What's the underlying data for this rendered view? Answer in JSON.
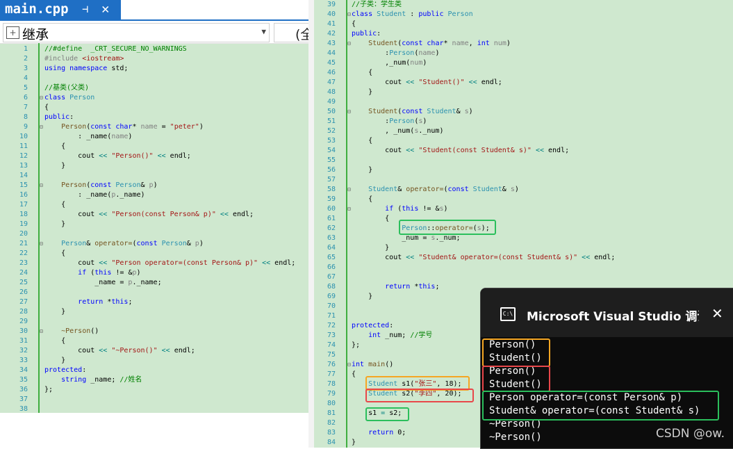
{
  "tab": {
    "title": "main.cpp",
    "pin_glyph": "⊣",
    "close_glyph": "✕"
  },
  "scope": {
    "left_value": "继承",
    "right_value": "(全"
  },
  "left_code": [
    {
      "n": "1",
      "segs": [
        [
          "com",
          "//#define  _CRT_SECURE_NO_WARNINGS"
        ]
      ]
    },
    {
      "n": "2",
      "segs": [
        [
          "pp",
          "#include "
        ],
        [
          "str",
          "<iostream>"
        ]
      ]
    },
    {
      "n": "3",
      "segs": [
        [
          "kw",
          "using namespace "
        ],
        [
          "mem",
          "std;"
        ]
      ]
    },
    {
      "n": "4",
      "segs": []
    },
    {
      "n": "5",
      "segs": [
        [
          "com",
          "//基类(父类)"
        ]
      ]
    },
    {
      "n": "6",
      "segs": [
        [
          "kw",
          "class "
        ],
        [
          "ty",
          "Person"
        ]
      ]
    },
    {
      "n": "7",
      "segs": [
        [
          "mem",
          "{"
        ]
      ]
    },
    {
      "n": "8",
      "segs": [
        [
          "kw",
          "public"
        ],
        [
          "mem",
          ":"
        ]
      ]
    },
    {
      "n": "9",
      "segs": [
        [
          "mem",
          "    "
        ],
        [
          "fn",
          "Person"
        ],
        [
          "mem",
          "("
        ],
        [
          "kw",
          "const char"
        ],
        [
          "mem",
          "* "
        ],
        [
          "par",
          "name"
        ],
        [
          "mem",
          " = "
        ],
        [
          "str",
          "\"peter\""
        ],
        [
          "mem",
          ")"
        ]
      ]
    },
    {
      "n": "10",
      "segs": [
        [
          "mem",
          "        : _name("
        ],
        [
          "par",
          "name"
        ],
        [
          "mem",
          ")"
        ]
      ]
    },
    {
      "n": "11",
      "segs": [
        [
          "mem",
          "    {"
        ]
      ]
    },
    {
      "n": "12",
      "segs": [
        [
          "mem",
          "        cout "
        ],
        [
          "op",
          "<<"
        ],
        [
          "mem",
          " "
        ],
        [
          "str",
          "\"Person()\""
        ],
        [
          "mem",
          " "
        ],
        [
          "op",
          "<<"
        ],
        [
          "mem",
          " endl;"
        ]
      ]
    },
    {
      "n": "13",
      "segs": [
        [
          "mem",
          "    }"
        ]
      ]
    },
    {
      "n": "14",
      "segs": []
    },
    {
      "n": "15",
      "segs": [
        [
          "mem",
          "    "
        ],
        [
          "fn",
          "Person"
        ],
        [
          "mem",
          "("
        ],
        [
          "kw",
          "const "
        ],
        [
          "ty",
          "Person"
        ],
        [
          "mem",
          "& "
        ],
        [
          "par",
          "p"
        ],
        [
          "mem",
          ")"
        ]
      ]
    },
    {
      "n": "16",
      "segs": [
        [
          "mem",
          "        : _name("
        ],
        [
          "par",
          "p"
        ],
        [
          "mem",
          "._name)"
        ]
      ]
    },
    {
      "n": "17",
      "segs": [
        [
          "mem",
          "    {"
        ]
      ]
    },
    {
      "n": "18",
      "segs": [
        [
          "mem",
          "        cout "
        ],
        [
          "op",
          "<<"
        ],
        [
          "mem",
          " "
        ],
        [
          "str",
          "\"Person(const Person& p)\""
        ],
        [
          "mem",
          " "
        ],
        [
          "op",
          "<<"
        ],
        [
          "mem",
          " endl;"
        ]
      ]
    },
    {
      "n": "19",
      "segs": [
        [
          "mem",
          "    }"
        ]
      ]
    },
    {
      "n": "20",
      "segs": []
    },
    {
      "n": "21",
      "segs": [
        [
          "mem",
          "    "
        ],
        [
          "ty",
          "Person"
        ],
        [
          "mem",
          "& "
        ],
        [
          "fn",
          "operator="
        ],
        [
          "mem",
          "("
        ],
        [
          "kw",
          "const "
        ],
        [
          "ty",
          "Person"
        ],
        [
          "mem",
          "& "
        ],
        [
          "par",
          "p"
        ],
        [
          "mem",
          ")"
        ]
      ]
    },
    {
      "n": "22",
      "segs": [
        [
          "mem",
          "    {"
        ]
      ]
    },
    {
      "n": "23",
      "segs": [
        [
          "mem",
          "        cout "
        ],
        [
          "op",
          "<<"
        ],
        [
          "mem",
          " "
        ],
        [
          "str",
          "\"Person operator=(const Person& p)\""
        ],
        [
          "mem",
          " "
        ],
        [
          "op",
          "<<"
        ],
        [
          "mem",
          " endl;"
        ]
      ]
    },
    {
      "n": "24",
      "segs": [
        [
          "mem",
          "        "
        ],
        [
          "kw",
          "if"
        ],
        [
          "mem",
          " ("
        ],
        [
          "kw",
          "this"
        ],
        [
          "mem",
          " != &"
        ],
        [
          "par",
          "p"
        ],
        [
          "mem",
          ")"
        ]
      ]
    },
    {
      "n": "25",
      "segs": [
        [
          "mem",
          "            _name = "
        ],
        [
          "par",
          "p"
        ],
        [
          "mem",
          "._name;"
        ]
      ]
    },
    {
      "n": "26",
      "segs": []
    },
    {
      "n": "27",
      "segs": [
        [
          "mem",
          "        "
        ],
        [
          "kw",
          "return"
        ],
        [
          "mem",
          " *"
        ],
        [
          "kw",
          "this"
        ],
        [
          "mem",
          ";"
        ]
      ]
    },
    {
      "n": "28",
      "segs": [
        [
          "mem",
          "    }"
        ]
      ]
    },
    {
      "n": "29",
      "segs": []
    },
    {
      "n": "30",
      "segs": [
        [
          "mem",
          "    "
        ],
        [
          "fn",
          "~Person"
        ],
        [
          "mem",
          "()"
        ]
      ]
    },
    {
      "n": "31",
      "segs": [
        [
          "mem",
          "    {"
        ]
      ]
    },
    {
      "n": "32",
      "segs": [
        [
          "mem",
          "        cout "
        ],
        [
          "op",
          "<<"
        ],
        [
          "mem",
          " "
        ],
        [
          "str",
          "\"~Person()\""
        ],
        [
          "mem",
          " "
        ],
        [
          "op",
          "<<"
        ],
        [
          "mem",
          " endl;"
        ]
      ]
    },
    {
      "n": "33",
      "segs": [
        [
          "mem",
          "    }"
        ]
      ]
    },
    {
      "n": "34",
      "segs": [
        [
          "kw",
          "protected"
        ],
        [
          "mem",
          ":"
        ]
      ]
    },
    {
      "n": "35",
      "segs": [
        [
          "mem",
          "    "
        ],
        [
          "kw",
          "string"
        ],
        [
          "mem",
          " _name; "
        ],
        [
          "com",
          "//姓名"
        ]
      ]
    },
    {
      "n": "36",
      "segs": [
        [
          "mem",
          "};"
        ]
      ]
    },
    {
      "n": "37",
      "segs": []
    },
    {
      "n": "38",
      "segs": []
    }
  ],
  "right_code": [
    {
      "n": "39",
      "segs": [
        [
          "com",
          "//子类：学生类"
        ]
      ]
    },
    {
      "n": "40",
      "segs": [
        [
          "kw",
          "class "
        ],
        [
          "ty",
          "Student"
        ],
        [
          "mem",
          " : "
        ],
        [
          "kw",
          "public "
        ],
        [
          "ty",
          "Person"
        ]
      ]
    },
    {
      "n": "41",
      "segs": [
        [
          "mem",
          "{"
        ]
      ]
    },
    {
      "n": "42",
      "segs": [
        [
          "kw",
          "public"
        ],
        [
          "mem",
          ":"
        ]
      ]
    },
    {
      "n": "43",
      "segs": [
        [
          "mem",
          "    "
        ],
        [
          "fn",
          "Student"
        ],
        [
          "mem",
          "("
        ],
        [
          "kw",
          "const char"
        ],
        [
          "mem",
          "* "
        ],
        [
          "par",
          "name"
        ],
        [
          "mem",
          ", "
        ],
        [
          "kw",
          "int"
        ],
        [
          "mem",
          " "
        ],
        [
          "par",
          "num"
        ],
        [
          "mem",
          ")"
        ]
      ]
    },
    {
      "n": "44",
      "segs": [
        [
          "mem",
          "        :"
        ],
        [
          "ty",
          "Person"
        ],
        [
          "mem",
          "("
        ],
        [
          "par",
          "name"
        ],
        [
          "mem",
          ")"
        ]
      ]
    },
    {
      "n": "45",
      "segs": [
        [
          "mem",
          "        ,_num("
        ],
        [
          "par",
          "num"
        ],
        [
          "mem",
          ")"
        ]
      ]
    },
    {
      "n": "46",
      "segs": [
        [
          "mem",
          "    {"
        ]
      ]
    },
    {
      "n": "47",
      "segs": [
        [
          "mem",
          "        cout "
        ],
        [
          "op",
          "<<"
        ],
        [
          "mem",
          " "
        ],
        [
          "str",
          "\"Student()\""
        ],
        [
          "mem",
          " "
        ],
        [
          "op",
          "<<"
        ],
        [
          "mem",
          " endl;"
        ]
      ]
    },
    {
      "n": "48",
      "segs": [
        [
          "mem",
          "    }"
        ]
      ]
    },
    {
      "n": "49",
      "segs": []
    },
    {
      "n": "50",
      "segs": [
        [
          "mem",
          "    "
        ],
        [
          "fn",
          "Student"
        ],
        [
          "mem",
          "("
        ],
        [
          "kw",
          "const "
        ],
        [
          "ty",
          "Student"
        ],
        [
          "mem",
          "& "
        ],
        [
          "par",
          "s"
        ],
        [
          "mem",
          ")"
        ]
      ]
    },
    {
      "n": "51",
      "segs": [
        [
          "mem",
          "        :"
        ],
        [
          "ty",
          "Person"
        ],
        [
          "mem",
          "("
        ],
        [
          "par",
          "s"
        ],
        [
          "mem",
          ")"
        ]
      ]
    },
    {
      "n": "52",
      "segs": [
        [
          "mem",
          "        , _num("
        ],
        [
          "par",
          "s"
        ],
        [
          "mem",
          "._num)"
        ]
      ]
    },
    {
      "n": "53",
      "segs": [
        [
          "mem",
          "    {"
        ]
      ]
    },
    {
      "n": "54",
      "segs": [
        [
          "mem",
          "        cout "
        ],
        [
          "op",
          "<<"
        ],
        [
          "mem",
          " "
        ],
        [
          "str",
          "\"Student(const Student& s)\""
        ],
        [
          "mem",
          " "
        ],
        [
          "op",
          "<<"
        ],
        [
          "mem",
          " endl;"
        ]
      ]
    },
    {
      "n": "55",
      "segs": []
    },
    {
      "n": "56",
      "segs": [
        [
          "mem",
          "    }"
        ]
      ]
    },
    {
      "n": "57",
      "segs": []
    },
    {
      "n": "58",
      "segs": [
        [
          "mem",
          "    "
        ],
        [
          "ty",
          "Student"
        ],
        [
          "mem",
          "& "
        ],
        [
          "fn",
          "operator="
        ],
        [
          "mem",
          "("
        ],
        [
          "kw",
          "const "
        ],
        [
          "ty",
          "Student"
        ],
        [
          "mem",
          "& "
        ],
        [
          "par",
          "s"
        ],
        [
          "mem",
          ")"
        ]
      ]
    },
    {
      "n": "59",
      "segs": [
        [
          "mem",
          "    {"
        ]
      ]
    },
    {
      "n": "60",
      "segs": [
        [
          "mem",
          "        "
        ],
        [
          "kw",
          "if"
        ],
        [
          "mem",
          " ("
        ],
        [
          "kw",
          "this"
        ],
        [
          "mem",
          " != &"
        ],
        [
          "par",
          "s"
        ],
        [
          "mem",
          ")"
        ]
      ]
    },
    {
      "n": "61",
      "segs": [
        [
          "mem",
          "        {"
        ]
      ]
    },
    {
      "n": "62",
      "segs": [
        [
          "mem",
          "            "
        ],
        [
          "ty",
          "Person"
        ],
        [
          "mem",
          "::"
        ],
        [
          "fn",
          "operator="
        ],
        [
          "mem",
          "("
        ],
        [
          "par",
          "s"
        ],
        [
          "mem",
          ");"
        ]
      ]
    },
    {
      "n": "63",
      "segs": [
        [
          "mem",
          "            _num = "
        ],
        [
          "par",
          "s"
        ],
        [
          "mem",
          "._num;"
        ]
      ]
    },
    {
      "n": "64",
      "segs": [
        [
          "mem",
          "        }"
        ]
      ]
    },
    {
      "n": "65",
      "segs": [
        [
          "mem",
          "        cout "
        ],
        [
          "op",
          "<<"
        ],
        [
          "mem",
          " "
        ],
        [
          "str",
          "\"Student& operator=(const Student& s)\""
        ],
        [
          "mem",
          " "
        ],
        [
          "op",
          "<<"
        ],
        [
          "mem",
          " endl;"
        ]
      ]
    },
    {
      "n": "66",
      "segs": []
    },
    {
      "n": "67",
      "segs": []
    },
    {
      "n": "68",
      "segs": [
        [
          "mem",
          "        "
        ],
        [
          "kw",
          "return"
        ],
        [
          "mem",
          " *"
        ],
        [
          "kw",
          "this"
        ],
        [
          "mem",
          ";"
        ]
      ]
    },
    {
      "n": "69",
      "segs": [
        [
          "mem",
          "    }"
        ]
      ]
    },
    {
      "n": "70",
      "segs": []
    },
    {
      "n": "71",
      "segs": []
    },
    {
      "n": "72",
      "segs": [
        [
          "kw",
          "protected"
        ],
        [
          "mem",
          ":"
        ]
      ]
    },
    {
      "n": "73",
      "segs": [
        [
          "mem",
          "    "
        ],
        [
          "kw",
          "int"
        ],
        [
          "mem",
          " _num; "
        ],
        [
          "com",
          "//学号"
        ]
      ]
    },
    {
      "n": "74",
      "segs": [
        [
          "mem",
          "};"
        ]
      ]
    },
    {
      "n": "75",
      "segs": []
    },
    {
      "n": "76",
      "segs": [
        [
          "kw",
          "int"
        ],
        [
          "mem",
          " "
        ],
        [
          "fn",
          "main"
        ],
        [
          "mem",
          "()"
        ]
      ]
    },
    {
      "n": "77",
      "segs": [
        [
          "mem",
          "{"
        ]
      ]
    },
    {
      "n": "78",
      "segs": [
        [
          "mem",
          "    "
        ],
        [
          "ty",
          "Student"
        ],
        [
          "mem",
          " s1("
        ],
        [
          "str",
          "\"张三\""
        ],
        [
          "mem",
          ", 18);"
        ]
      ]
    },
    {
      "n": "79",
      "segs": [
        [
          "mem",
          "    "
        ],
        [
          "ty",
          "Student"
        ],
        [
          "mem",
          " s2("
        ],
        [
          "str",
          "\"李四\""
        ],
        [
          "mem",
          ", 20);"
        ]
      ]
    },
    {
      "n": "80",
      "segs": []
    },
    {
      "n": "81",
      "segs": [
        [
          "mem",
          "    s1 "
        ],
        [
          "op",
          "="
        ],
        [
          "mem",
          " s2;"
        ]
      ]
    },
    {
      "n": "82",
      "segs": []
    },
    {
      "n": "83",
      "segs": [
        [
          "mem",
          "    "
        ],
        [
          "kw",
          "return"
        ],
        [
          "mem",
          " 0;"
        ]
      ]
    },
    {
      "n": "84",
      "segs": [
        [
          "mem",
          "}"
        ]
      ]
    }
  ],
  "console": {
    "title": "Microsoft Visual Studio 调试控制台",
    "icon_text": "C:\\",
    "close_glyph": "✕",
    "lines": [
      "Person()",
      "Student()",
      "Person()",
      "Student()",
      "Person operator=(const Person& p)",
      "Student& operator=(const Student& s)",
      "~Person()",
      "~Person()"
    ]
  },
  "watermark": "CSDN @ow.",
  "colors": {
    "editor_bg": "#cfe8cf",
    "tab_active": "#1f6fc5",
    "highlight_orange": "#f5a623",
    "highlight_red": "#e8474a",
    "highlight_green": "#2bbf5c",
    "console_bg": "#0c0c0c"
  }
}
